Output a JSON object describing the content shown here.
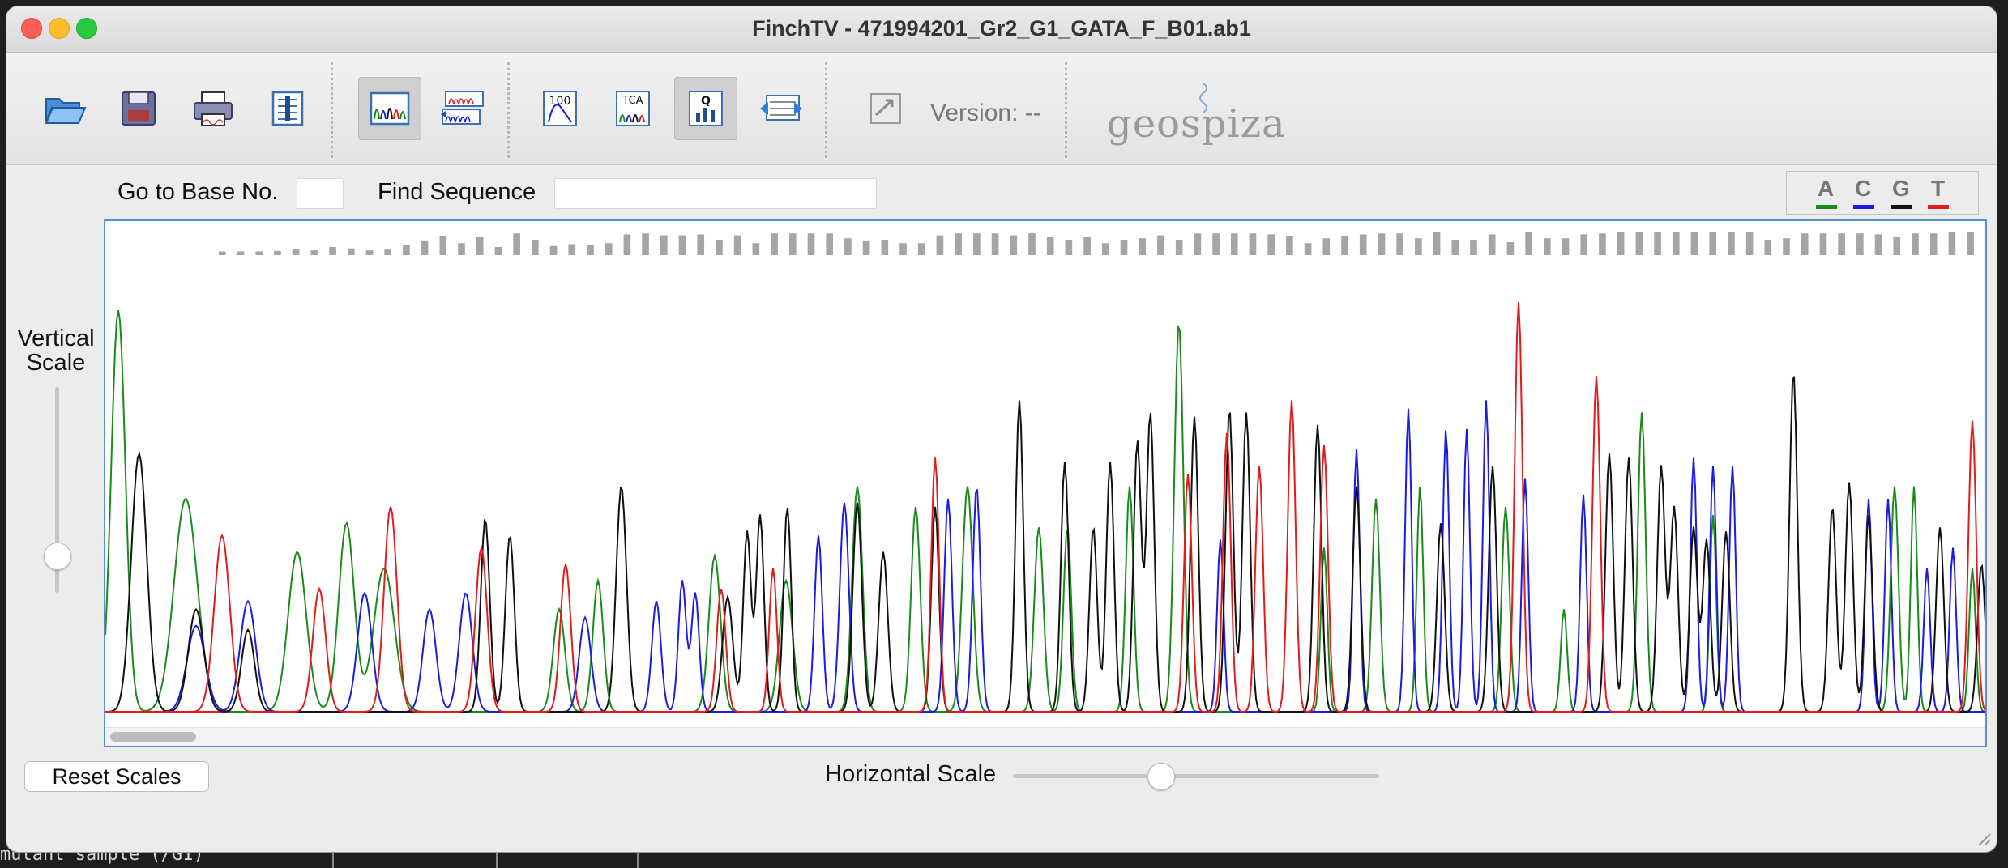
{
  "window": {
    "title": "FinchTV - 471994201_Gr2_G1_GATA_F_B01.ab1"
  },
  "toolbar": {
    "buttons": [
      {
        "name": "open-folder",
        "icon": "folder-open-icon",
        "active": false
      },
      {
        "name": "save",
        "icon": "floppy-disk-icon",
        "active": false
      },
      {
        "name": "print",
        "icon": "printer-icon",
        "active": false
      },
      {
        "name": "info",
        "icon": "info-panel-icon",
        "active": false
      },
      {
        "name": "single-view",
        "icon": "chromatogram-single-icon",
        "active": true
      },
      {
        "name": "multi-view",
        "icon": "chromatogram-multi-icon",
        "active": false
      },
      {
        "name": "peak-100",
        "icon": "peak-100-icon",
        "active": false
      },
      {
        "name": "tca",
        "icon": "tca-icon",
        "active": false
      },
      {
        "name": "quality",
        "icon": "quality-bars-icon",
        "active": true
      },
      {
        "name": "wrap",
        "icon": "wrap-arrow-icon",
        "active": false
      },
      {
        "name": "plugin",
        "icon": "plugin-arrow-icon",
        "active": false
      }
    ],
    "version_label": "Version: --",
    "logo_text": "geospiza"
  },
  "controls": {
    "goto_label": "Go to Base No.",
    "goto_value": "",
    "find_label": "Find Sequence",
    "find_value": "",
    "vertical_scale_label": "Vertical Scale",
    "vertical_scale_level": 0.15,
    "horizontal_scale_label": "Horizontal Scale",
    "horizontal_scale_level": 0.38,
    "reset_label": "Reset Scales"
  },
  "legend": [
    {
      "base": "A",
      "color": "#1a8a1a"
    },
    {
      "base": "C",
      "color": "#1c1ce0"
    },
    {
      "base": "G",
      "color": "#111111"
    },
    {
      "base": "T",
      "color": "#e01c1c"
    }
  ],
  "colors": {
    "A": "#1a8a1a",
    "C": "#1c1ce0",
    "G": "#111111",
    "T": "#e01c1c",
    "quality": "#a5a5a5"
  },
  "chart_data": {
    "type": "line",
    "x_range": [
      0,
      1450
    ],
    "y_range": [
      0,
      1
    ],
    "quality": [
      0.02,
      0.02,
      0.02,
      0.05,
      0.12,
      0.08,
      0.25,
      0.18,
      0.08,
      0.12,
      0.35,
      0.55,
      0.8,
      0.45,
      0.75,
      0.25,
      0.95,
      0.6,
      0.3,
      0.4,
      0.35,
      0.45,
      0.9,
      0.95,
      0.85,
      0.85,
      0.9,
      0.6,
      0.85,
      0.45,
      0.95,
      0.95,
      0.95,
      0.95,
      0.7,
      0.55,
      0.6,
      0.45,
      0.45,
      0.85,
      0.95,
      0.95,
      0.95,
      0.85,
      0.95,
      0.75,
      0.6,
      0.75,
      0.45,
      0.6,
      0.7,
      0.85,
      0.6,
      0.95,
      0.95,
      0.95,
      0.95,
      0.9,
      0.8,
      0.45,
      0.7,
      0.8,
      0.9,
      0.95,
      0.95,
      0.7,
      1.0,
      0.6,
      0.6,
      0.9,
      0.5,
      1.0,
      0.7,
      0.7,
      0.9,
      0.95,
      1.0,
      1.0,
      1.0,
      1.0,
      1.0,
      1.0,
      1.0,
      1.0,
      0.6,
      0.7,
      0.95,
      0.95,
      0.95,
      0.95,
      0.9,
      0.75,
      0.95,
      0.95,
      1.0,
      1.0
    ],
    "peaks": {
      "A": [
        [
          10,
          0.98,
          11
        ],
        [
          62,
          0.52,
          18
        ],
        [
          148,
          0.39,
          14
        ],
        [
          186,
          0.46,
          12
        ],
        [
          215,
          0.35,
          16
        ],
        [
          350,
          0.25,
          9
        ],
        [
          380,
          0.32,
          8
        ],
        [
          470,
          0.38,
          9
        ],
        [
          525,
          0.32,
          10
        ],
        [
          580,
          0.55,
          8
        ],
        [
          625,
          0.5,
          7
        ],
        [
          665,
          0.55,
          8
        ],
        [
          720,
          0.45,
          7
        ],
        [
          742,
          0.45,
          6
        ],
        [
          790,
          0.55,
          6
        ],
        [
          828,
          0.95,
          7
        ],
        [
          940,
          0.4,
          5
        ],
        [
          980,
          0.52,
          6
        ],
        [
          1014,
          0.55,
          5
        ],
        [
          1080,
          0.5,
          6
        ],
        [
          1125,
          0.25,
          5
        ],
        [
          1185,
          0.73,
          6
        ],
        [
          1240,
          0.48,
          5
        ],
        [
          1380,
          0.55,
          6
        ],
        [
          1395,
          0.55,
          5
        ],
        [
          1440,
          0.35,
          5
        ]
      ],
      "C": [
        [
          70,
          0.21,
          14
        ],
        [
          110,
          0.27,
          12
        ],
        [
          200,
          0.29,
          11
        ],
        [
          250,
          0.25,
          10
        ],
        [
          278,
          0.29,
          10
        ],
        [
          370,
          0.23,
          9
        ],
        [
          425,
          0.27,
          7
        ],
        [
          445,
          0.32,
          6
        ],
        [
          455,
          0.29,
          6
        ],
        [
          550,
          0.43,
          6
        ],
        [
          570,
          0.51,
          7
        ],
        [
          650,
          0.52,
          6
        ],
        [
          672,
          0.55,
          6
        ],
        [
          860,
          0.42,
          5
        ],
        [
          965,
          0.64,
          5
        ],
        [
          1005,
          0.74,
          5
        ],
        [
          1034,
          0.69,
          5
        ],
        [
          1050,
          0.69,
          5
        ],
        [
          1065,
          0.76,
          5
        ],
        [
          1095,
          0.57,
          5
        ],
        [
          1140,
          0.53,
          5
        ],
        [
          1225,
          0.62,
          5
        ],
        [
          1240,
          0.6,
          5
        ],
        [
          1255,
          0.6,
          5
        ],
        [
          1360,
          0.52,
          5
        ],
        [
          1375,
          0.52,
          5
        ],
        [
          1405,
          0.35,
          5
        ],
        [
          1425,
          0.4,
          5
        ]
      ],
      "G": [
        [
          26,
          0.63,
          12
        ],
        [
          70,
          0.25,
          12
        ],
        [
          110,
          0.2,
          10
        ],
        [
          293,
          0.47,
          7
        ],
        [
          312,
          0.43,
          7
        ],
        [
          398,
          0.55,
          8
        ],
        [
          480,
          0.28,
          8
        ],
        [
          495,
          0.44,
          6
        ],
        [
          505,
          0.48,
          6
        ],
        [
          526,
          0.5,
          6
        ],
        [
          580,
          0.51,
          7
        ],
        [
          600,
          0.39,
          7
        ],
        [
          640,
          0.5,
          6
        ],
        [
          705,
          0.76,
          6
        ],
        [
          740,
          0.61,
          6
        ],
        [
          762,
          0.45,
          6
        ],
        [
          775,
          0.61,
          6
        ],
        [
          796,
          0.66,
          6
        ],
        [
          806,
          0.73,
          6
        ],
        [
          840,
          0.72,
          6
        ],
        [
          867,
          0.74,
          6
        ],
        [
          880,
          0.73,
          6
        ],
        [
          935,
          0.7,
          6
        ],
        [
          965,
          0.55,
          6
        ],
        [
          1030,
          0.46,
          6
        ],
        [
          1070,
          0.6,
          6
        ],
        [
          1160,
          0.63,
          6
        ],
        [
          1175,
          0.62,
          6
        ],
        [
          1200,
          0.6,
          6
        ],
        [
          1210,
          0.5,
          6
        ],
        [
          1225,
          0.45,
          6
        ],
        [
          1235,
          0.42,
          6
        ],
        [
          1250,
          0.44,
          6
        ],
        [
          1302,
          0.83,
          6
        ],
        [
          1332,
          0.5,
          6
        ],
        [
          1345,
          0.56,
          6
        ],
        [
          1360,
          0.48,
          6
        ],
        [
          1415,
          0.45,
          6
        ],
        [
          1447,
          0.36,
          6
        ]
      ],
      "T": [
        [
          90,
          0.43,
          12
        ],
        [
          165,
          0.3,
          10
        ],
        [
          220,
          0.5,
          10
        ],
        [
          290,
          0.4,
          9
        ],
        [
          355,
          0.36,
          8
        ],
        [
          475,
          0.3,
          7
        ],
        [
          515,
          0.35,
          6
        ],
        [
          640,
          0.62,
          6
        ],
        [
          835,
          0.58,
          6
        ],
        [
          865,
          0.68,
          6
        ],
        [
          890,
          0.6,
          6
        ],
        [
          915,
          0.76,
          6
        ],
        [
          940,
          0.65,
          6
        ],
        [
          1090,
          1.0,
          6
        ],
        [
          1150,
          0.82,
          6
        ],
        [
          1440,
          0.71,
          6
        ]
      ]
    }
  }
}
